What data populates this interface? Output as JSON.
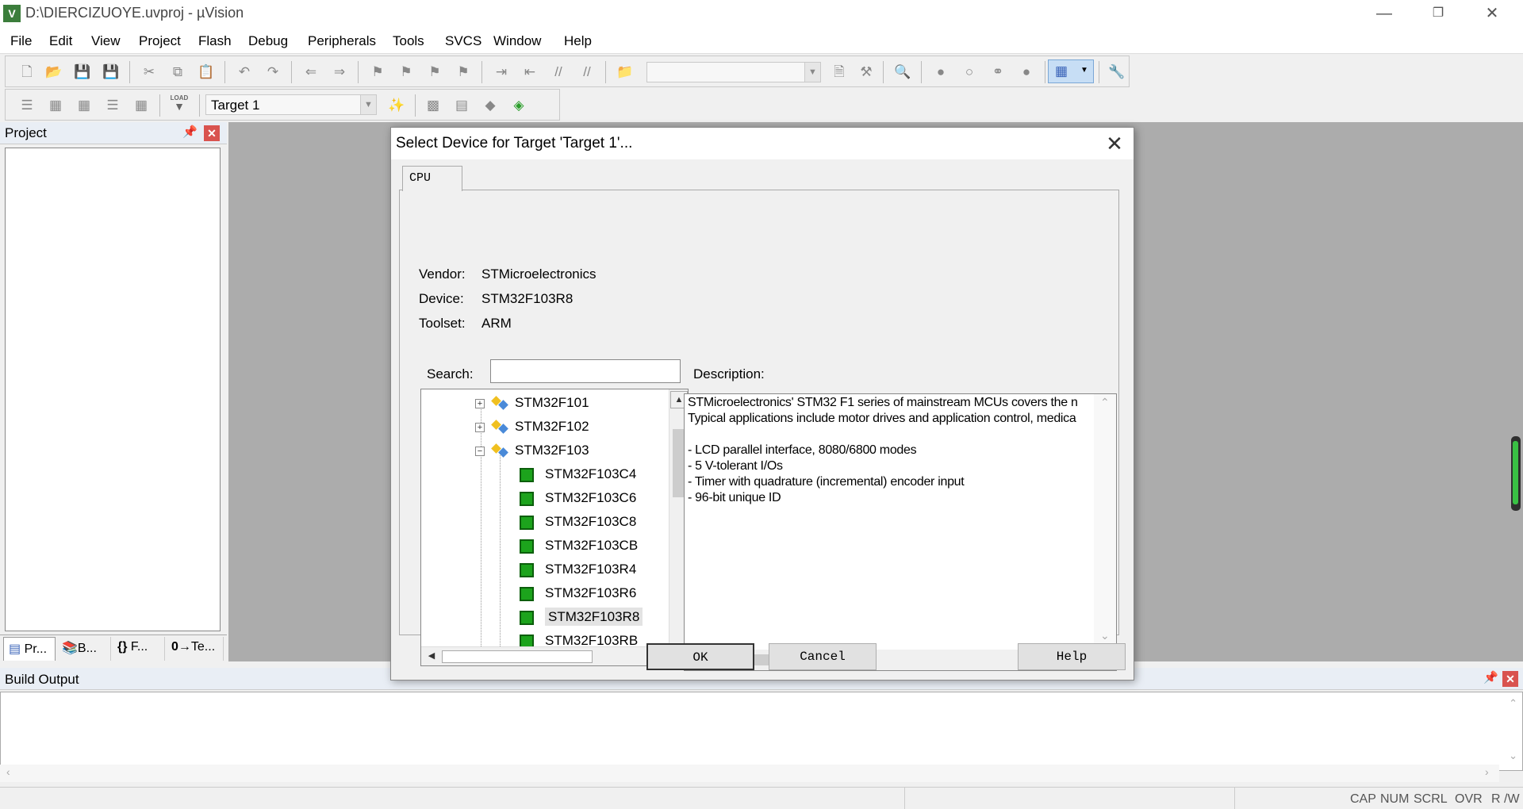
{
  "window": {
    "title": "D:\\DIERCIZUOYE.uvproj - µVision",
    "app_icon": "V"
  },
  "menu": [
    "File",
    "Edit",
    "View",
    "Project",
    "Flash",
    "Debug",
    "Peripherals",
    "Tools",
    "SVCS",
    "Window",
    "Help"
  ],
  "toolbar2": {
    "load_label": "LOAD",
    "target_select": "Target 1"
  },
  "project_panel": {
    "title": "Project",
    "tabs": [
      "Pr...",
      "B...",
      "F...",
      "Te..."
    ]
  },
  "build_output": {
    "title": "Build Output"
  },
  "statusbar": {
    "indicators": [
      "CAP",
      "NUM",
      "SCRL",
      "OVR",
      "R /W"
    ]
  },
  "dialog": {
    "title": "Select Device for Target 'Target 1'...",
    "tab": "CPU",
    "vendor_label": "Vendor:",
    "vendor_value": "STMicroelectronics",
    "device_label": "Device:",
    "device_value": "STM32F103R8",
    "toolset_label": "Toolset:",
    "toolset_value": "ARM",
    "search_label": "Search:",
    "search_value": "",
    "description_label": "Description:",
    "tree": {
      "families": [
        "STM32F101",
        "STM32F102",
        "STM32F103"
      ],
      "devices": [
        "STM32F103C4",
        "STM32F103C6",
        "STM32F103C8",
        "STM32F103CB",
        "STM32F103R4",
        "STM32F103R6",
        "STM32F103R8",
        "STM32F103RB"
      ],
      "selected": "STM32F103R8"
    },
    "description_lines": [
      "STMicroelectronics' STM32 F1 series of mainstream MCUs covers the n",
      "Typical applications include motor drives and application control, medica",
      "",
      " - LCD parallel interface, 8080/6800 modes",
      " - 5 V-tolerant I/Os",
      " - Timer with quadrature (incremental) encoder input",
      " - 96-bit unique ID"
    ],
    "buttons": {
      "ok": "OK",
      "cancel": "Cancel",
      "help": "Help"
    }
  }
}
